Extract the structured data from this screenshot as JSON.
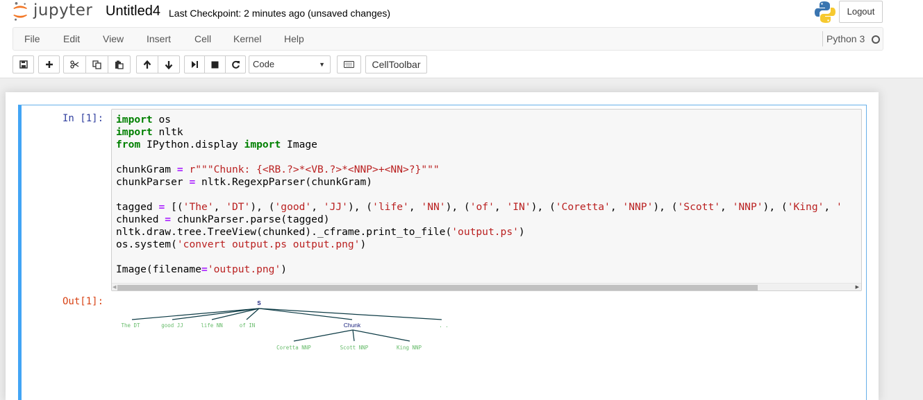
{
  "header": {
    "logo_text": "jupyter",
    "notebook_name": "Untitled4",
    "checkpoint": "Last Checkpoint: 2 minutes ago (unsaved changes)",
    "logout_label": "Logout"
  },
  "menu": {
    "items": [
      "File",
      "Edit",
      "View",
      "Insert",
      "Cell",
      "Kernel",
      "Help"
    ],
    "kernel_name": "Python 3"
  },
  "toolbar": {
    "buttons": [
      "save-icon",
      "plus-icon",
      "cut-icon",
      "copy-icon",
      "paste-icon",
      "arrow-up-icon",
      "arrow-down-icon",
      "step-forward-icon",
      "stop-icon",
      "refresh-icon",
      "keyboard-icon"
    ],
    "cell_type": "Code",
    "celltoolbar_label": "CellToolbar"
  },
  "cell": {
    "in_prompt": "In [1]:",
    "out_prompt": "Out[1]:",
    "code_lines": [
      "import os",
      "import nltk",
      "from IPython.display import Image",
      "",
      "chunkGram = r\"\"\"Chunk: {<RB.?>*<VB.?>*<NNP>+<NN>?}\"\"\"",
      "chunkParser = nltk.RegexpParser(chunkGram)",
      "",
      "tagged = [('The', 'DT'), ('good', 'JJ'), ('life', 'NN'), ('of', 'IN'), ('Coretta', 'NNP'), ('Scott', 'NNP'), ('King', '",
      "chunked = chunkParser.parse(tagged)",
      "nltk.draw.tree.TreeView(chunked)._cframe.print_to_file('output.ps')",
      "os.system('convert output.ps output.png')",
      "",
      "Image(filename='output.png')"
    ]
  },
  "tree": {
    "root": "S",
    "leaves": [
      "The DT",
      "good JJ",
      "life NN",
      "of IN",
      ". ."
    ],
    "chunk_label": "Chunk",
    "chunk_leaves": [
      "Coretta NNP",
      "Scott NNP",
      "King NNP"
    ]
  },
  "colors": {
    "keyword": "#008000",
    "string": "#ba2121",
    "in_prompt": "#303f9f",
    "out_prompt": "#d84315",
    "cell_border": "#42a5f5",
    "tree_label": "#1a237e",
    "tree_leaf": "#66bb6a"
  }
}
